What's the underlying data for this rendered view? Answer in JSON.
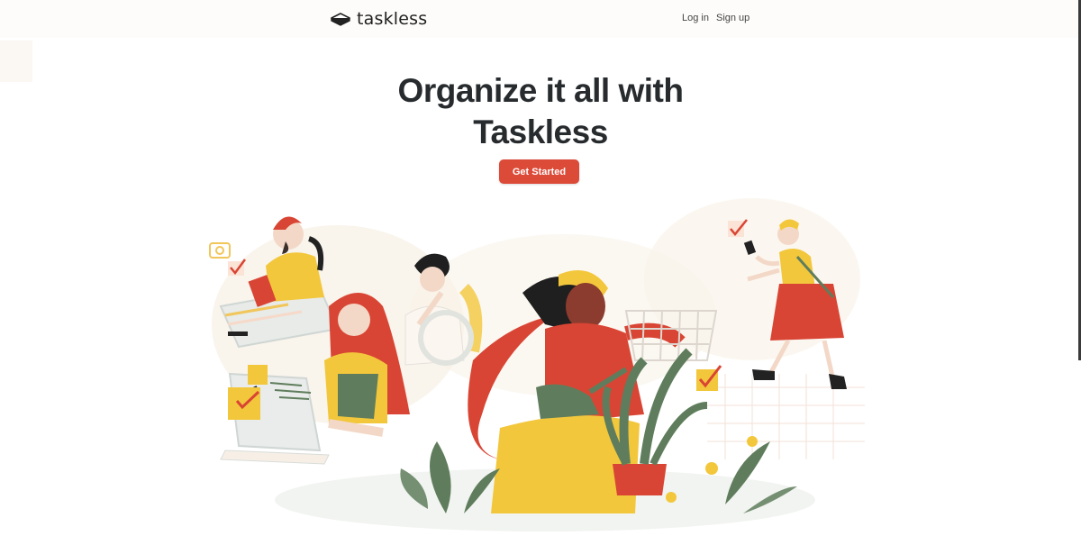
{
  "brand": {
    "name": "taskless",
    "logo_icon": "stacked-paper-icon"
  },
  "nav": {
    "login_label": "Log in",
    "signup_label": "Sign up"
  },
  "hero": {
    "title_line1": "Organize it all with",
    "title_line2": "Taskless",
    "cta_label": "Get Started"
  },
  "colors": {
    "accent": "#dc4a38",
    "title": "#272b2e",
    "yellow": "#f3c73c",
    "green": "#5f7d5c",
    "red": "#d94534"
  }
}
